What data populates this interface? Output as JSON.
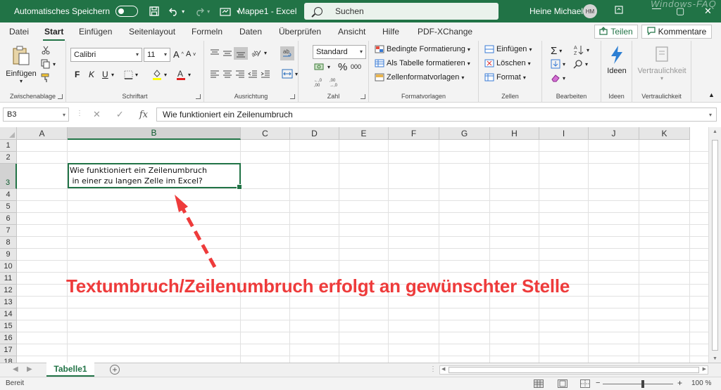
{
  "titlebar": {
    "autosave_label": "Automatisches Speichern",
    "title": "Mappe1 - Excel",
    "search_placeholder": "Suchen",
    "user_name": "Heine Michael",
    "user_initials": "HM",
    "watermark": "Windows-FAQ",
    "minimize": "—",
    "restore": "▢",
    "close": "✕"
  },
  "menu": {
    "tabs": [
      "Datei",
      "Start",
      "Einfügen",
      "Seitenlayout",
      "Formeln",
      "Daten",
      "Überprüfen",
      "Ansicht",
      "Hilfe",
      "PDF-XChange"
    ],
    "active": "Start",
    "share_label": "Teilen",
    "comments_label": "Kommentare"
  },
  "ribbon": {
    "clipboard": {
      "paste_label": "Einfügen",
      "group_label": "Zwischenablage"
    },
    "font": {
      "font_name": "Calibri",
      "font_size": "11",
      "group_label": "Schriftart",
      "bold": "F",
      "italic": "K",
      "underline": "U"
    },
    "alignment": {
      "group_label": "Ausrichtung"
    },
    "number": {
      "format": "Standard",
      "group_label": "Zahl",
      "percent": "%",
      "thousands": "000"
    },
    "styles": {
      "conditional": "Bedingte Formatierung",
      "as_table": "Als Tabelle formatieren",
      "cell_styles": "Zellenformatvorlagen",
      "group_label": "Formatvorlagen"
    },
    "cells": {
      "insert": "Einfügen",
      "delete": "Löschen",
      "format": "Format",
      "group_label": "Zellen"
    },
    "editing": {
      "group_label": "Bearbeiten"
    },
    "ideas": {
      "label": "Ideen",
      "group_label": "Ideen"
    },
    "sensitivity": {
      "label": "Vertraulichkeit",
      "group_label": "Vertraulichkeit"
    }
  },
  "formula_bar": {
    "name_box": "B3",
    "cancel": "✕",
    "enter": "✓",
    "fx": "fx",
    "content": "Wie funktioniert ein Zeilenumbruch"
  },
  "grid": {
    "columns": [
      "A",
      "B",
      "C",
      "D",
      "E",
      "F",
      "G",
      "H",
      "I",
      "J",
      "K"
    ],
    "rows": [
      "1",
      "2",
      "3",
      "4",
      "5",
      "6",
      "7",
      "8",
      "9",
      "10",
      "11",
      "12",
      "13",
      "14",
      "15",
      "16",
      "17",
      "18"
    ],
    "selected_col": "B",
    "selected_row": "3",
    "cell_b3": "Wie funktioniert ein Zeilenumbruch\n in einer zu langen Zelle im Excel?"
  },
  "annotation": {
    "text": "Textumbruch/Zeilenumbruch erfolgt an gewünschter Stelle",
    "color": "#ee3b3b"
  },
  "sheets": {
    "tabs": [
      "Tabelle1"
    ],
    "active": "Tabelle1"
  },
  "status": {
    "ready": "Bereit",
    "zoom": "100 %"
  },
  "colors": {
    "accent": "#217346"
  }
}
